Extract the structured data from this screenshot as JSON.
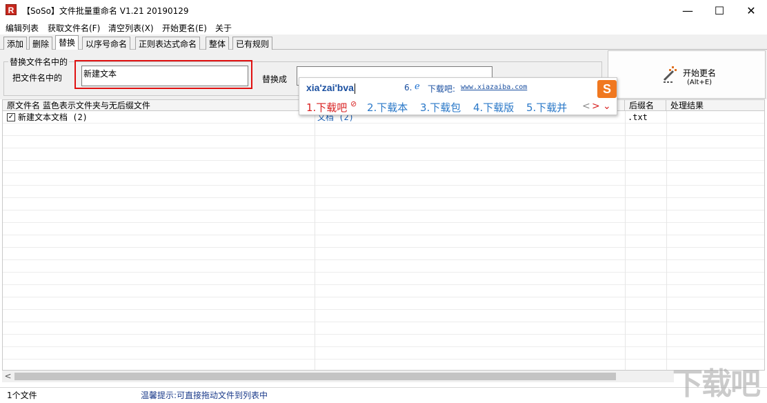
{
  "window": {
    "icon_letter": "R",
    "title": "【SoSo】文件批量重命名   V1.21 20190129",
    "min_symbol": "—",
    "max_symbol": "☐",
    "close_symbol": "✕"
  },
  "menu": [
    "编辑列表",
    "获取文件名(F)",
    "清空列表(X)",
    "开始更名(E)",
    "关于"
  ],
  "tabs": [
    "添加",
    "删除",
    "替换",
    "以序号命名",
    "正则表达式命名",
    "整体",
    "已有规则"
  ],
  "active_tab": "替换",
  "replace_panel": {
    "group_title": "替换文件名中的",
    "find_label": "把文件名中的",
    "find_value": "新建文本",
    "replace_label": "替换成",
    "replace_value": ""
  },
  "rename_button": {
    "label": "开始更名",
    "hotkey": "(Alt+E)",
    "icon": "rename-wand-icon"
  },
  "file_list": {
    "columns": [
      "原文件名  蓝色表示文件夹与无后缀文件",
      "",
      "后缀名",
      "处理结果"
    ],
    "rows": [
      {
        "checked": true,
        "check_mark": "✓",
        "original": "新建文本文档 (2)",
        "new_name": "文档 (2)",
        "extension": ".txt",
        "result": ""
      }
    ]
  },
  "scrollbar": {
    "left_arrow": "<"
  },
  "status": {
    "file_count": "1个文件",
    "hint": "温馨提示:可直接拖动文件到列表中"
  },
  "ime": {
    "composition": "xia'zai'bva",
    "hint_number": "6.",
    "hint_text": "下载吧:",
    "hint_url": "www.xiazaiba.com",
    "logo": "S",
    "candidates": [
      "1.下载吧",
      "2.下载本",
      "3.下载包",
      "4.下载版",
      "5.下载并"
    ],
    "nav": [
      "<",
      ">",
      "⌄"
    ]
  },
  "watermark": "下载吧",
  "colors": {
    "highlight_border": "#e01010",
    "ime_first_candidate": "#d81e1e",
    "ime_candidate": "#2a78c8",
    "status_hint": "#1a3a8a"
  }
}
